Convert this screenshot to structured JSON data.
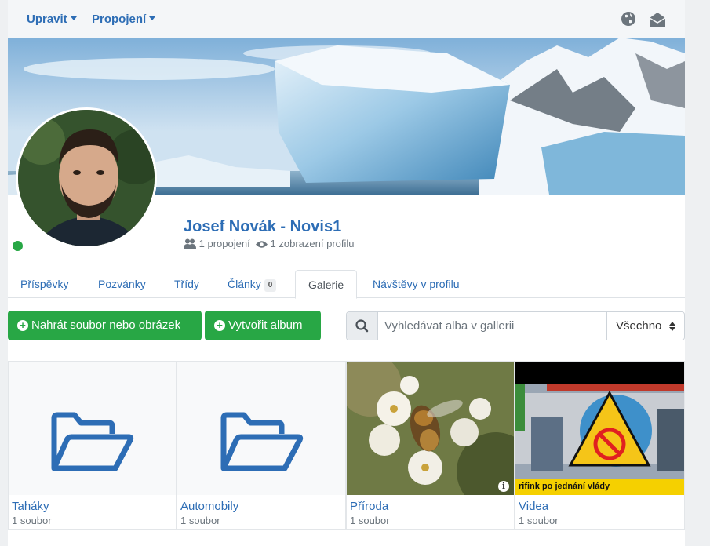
{
  "nav": {
    "edit_label": "Upravit",
    "connections_label": "Propojení",
    "globe_icon": "globe-icon",
    "mail_icon": "envelope-open-icon"
  },
  "profile": {
    "name": "Josef Novák - Novis1",
    "connections": "1 propojení",
    "views": "1 zobrazení profilu",
    "online_color": "#28a745"
  },
  "tabs": [
    {
      "label": "Příspěvky"
    },
    {
      "label": "Pozvánky"
    },
    {
      "label": "Třídy"
    },
    {
      "label": "Články",
      "badge": "0"
    },
    {
      "label": "Galerie",
      "active": true
    },
    {
      "label": "Návštěvy v profilu"
    }
  ],
  "actions": {
    "upload_label": "Nahrát soubor nebo obrázek",
    "create_album_label": "Vytvořit album"
  },
  "search": {
    "placeholder": "Vyhledávat alba v gallerii",
    "filter_value": "Všechno"
  },
  "albums": [
    {
      "title": "Taháky",
      "count": "1 soubor",
      "thumb": "folder-icon"
    },
    {
      "title": "Automobily",
      "count": "1 soubor",
      "thumb": "folder-icon"
    },
    {
      "title": "Příroda",
      "count": "1 soubor",
      "thumb": "bee-on-blossom-photo"
    },
    {
      "title": "Videa",
      "count": "1 soubor",
      "thumb": "news-video-still",
      "ticker": "rifink po jednání vlády"
    }
  ],
  "colors": {
    "accent": "#2d6db5",
    "success": "#28a745"
  }
}
